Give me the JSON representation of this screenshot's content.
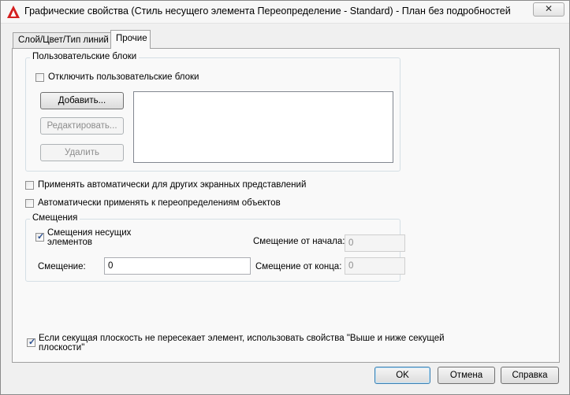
{
  "window": {
    "title": "Графические свойства (Стиль несущего элемента Переопределение - Standard) - План без подробностей",
    "close_symbol": "✕"
  },
  "tabs": [
    {
      "label": "Слой/Цвет/Тип линий",
      "active": false
    },
    {
      "label": "Прочие",
      "active": true
    }
  ],
  "custom_blocks": {
    "group_label": "Пользовательские блоки",
    "disable_checkbox": {
      "label": "Отключить пользовательские блоки",
      "checked": false
    },
    "add_button": "Добавить...",
    "edit_button": "Редактировать...",
    "delete_button": "Удалить"
  },
  "apply_auto_other": {
    "label": "Применять автоматически для других экранных представлений",
    "checked": false
  },
  "apply_auto_overrides": {
    "label": "Автоматически применять к переопределениям объектов",
    "checked": false
  },
  "offsets": {
    "group_label": "Смещения",
    "member_offsets": {
      "label_line1": "Смещения несущих",
      "label_line2": "элементов",
      "checked": true
    },
    "offset_label": "Смещение:",
    "offset_value": "0",
    "start_offset_label": "Смещение от начала:",
    "start_offset_value": "0",
    "end_offset_label": "Смещение от конца:",
    "end_offset_value": "0"
  },
  "cut_plane": {
    "label_line1": "Если секущая плоскость не пересекает элемент, использовать свойства \"Выше и ниже секущей",
    "label_line2": "плоскости\"",
    "checked": true
  },
  "footer": {
    "ok": "OK",
    "cancel": "Отмена",
    "help": "Справка"
  },
  "icons": {
    "app": "autocad-logo-icon",
    "check": "✓"
  },
  "colors": {
    "app_icon": "#d41f1f",
    "check_mark": "#2a4f91",
    "default_button_border": "#3c7fb1"
  }
}
